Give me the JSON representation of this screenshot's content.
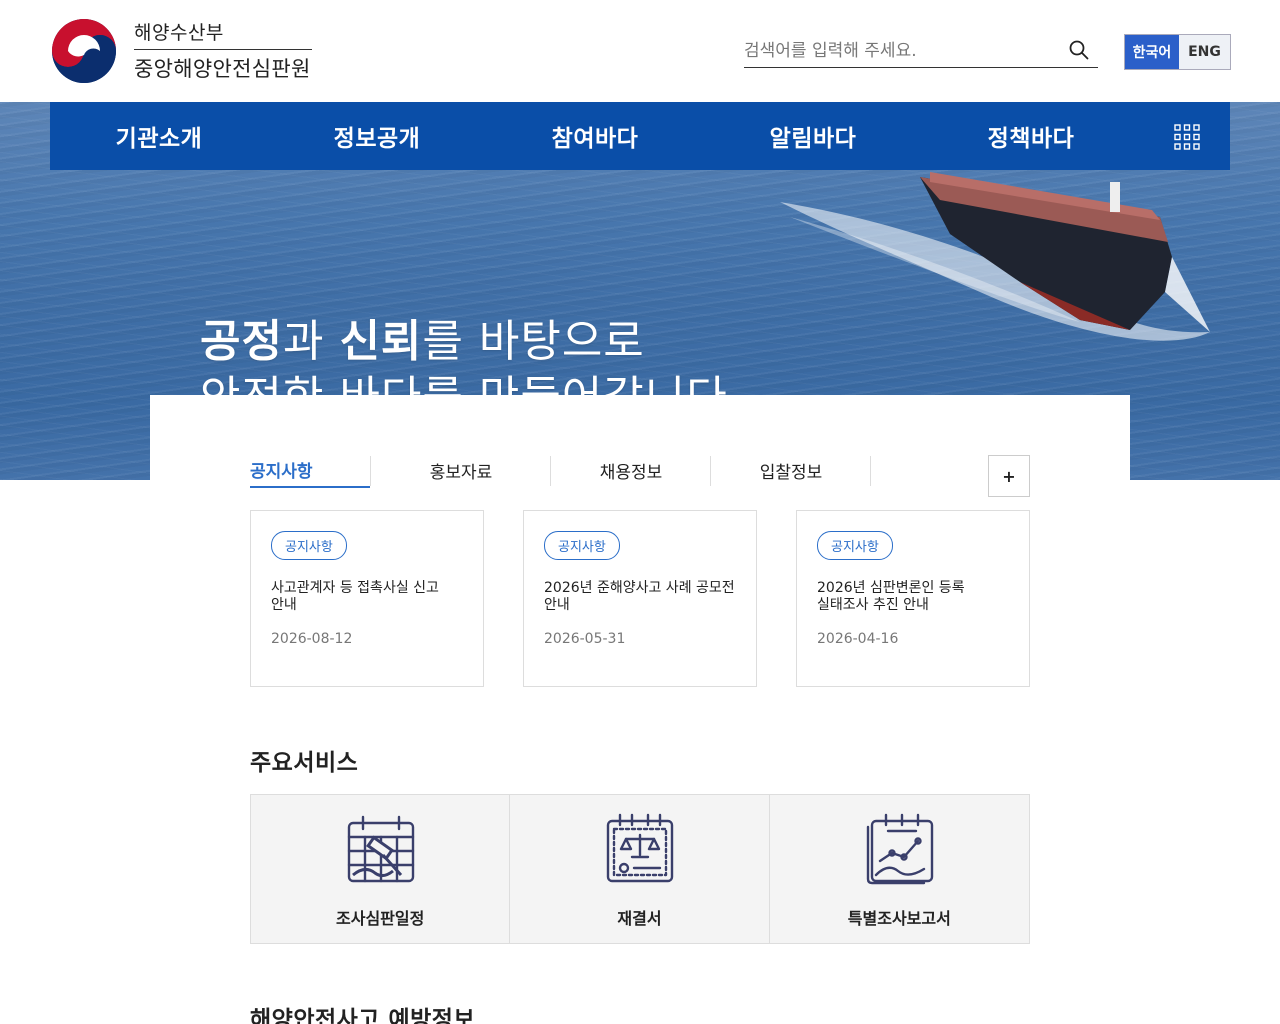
{
  "header": {
    "org_line1": "해양수산부",
    "org_line2": "중앙해양안전심판원",
    "search_placeholder": "검색어를 입력해 주세요.",
    "lang": {
      "ko": "한국어",
      "en": "ENG",
      "active": "ko"
    },
    "colors": {
      "nav_bg": "#0a4ea8",
      "accent": "#2b6ec9",
      "lang_active": "#2b5fc9"
    }
  },
  "nav": {
    "items": [
      "기관소개",
      "정보공개",
      "참여바다",
      "알림바다",
      "정책바다"
    ],
    "grid_icon": "grid-menu-icon"
  },
  "hero": {
    "line1_bold1": "공정",
    "line1_mid": "과 ",
    "line1_bold2": "신뢰",
    "line1_rest": "를 바탕으로",
    "line2": "안전한 바다를 만들어갑니다."
  },
  "board": {
    "tabs": [
      "공지사항",
      "홍보자료",
      "채용정보",
      "입찰정보"
    ],
    "active_tab": 0,
    "more_label": "+",
    "cards": [
      {
        "badge": "공지사항",
        "title": "사고관계자 등 접촉사실 신고 안내",
        "date": "2026-08-12"
      },
      {
        "badge": "공지사항",
        "title": "2026년 준해양사고 사례 공모전 안내",
        "date": "2026-05-31"
      },
      {
        "badge": "공지사항",
        "title": "2026년 심판변론인 등록 실태조사 추진 안내",
        "date": "2026-04-16"
      }
    ]
  },
  "services": {
    "title": "주요서비스",
    "items": [
      {
        "label": "조사심판일정",
        "icon": "calendar-gavel-icon"
      },
      {
        "label": "재결서",
        "icon": "scales-document-icon"
      },
      {
        "label": "특별조사보고서",
        "icon": "chart-report-icon"
      }
    ]
  },
  "prevention": {
    "title": "해양안전사고 예방정보"
  }
}
